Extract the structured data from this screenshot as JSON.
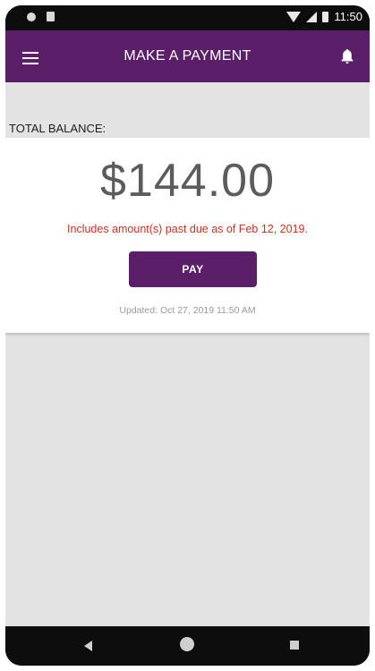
{
  "status_bar": {
    "time": "11:50",
    "icons": [
      "notification-dot-icon",
      "sd-card-icon",
      "wifi-icon",
      "signal-icon",
      "battery-icon"
    ]
  },
  "app_bar": {
    "title": "MAKE A PAYMENT",
    "left_icon": "menu-icon",
    "right_icon": "bell-icon",
    "color": "#5a1f68"
  },
  "balance": {
    "label": "TOTAL BALANCE:",
    "amount": "$144.00",
    "past_due_notice": "Includes amount(s) past due as of Feb 12, 2019.",
    "pay_label": "PAY",
    "updated": "Updated: Oct 27, 2019 11:50 AM",
    "notice_color": "#c8341f"
  },
  "nav_bar": {
    "icons": [
      "back-icon",
      "home-icon",
      "recents-icon"
    ]
  }
}
